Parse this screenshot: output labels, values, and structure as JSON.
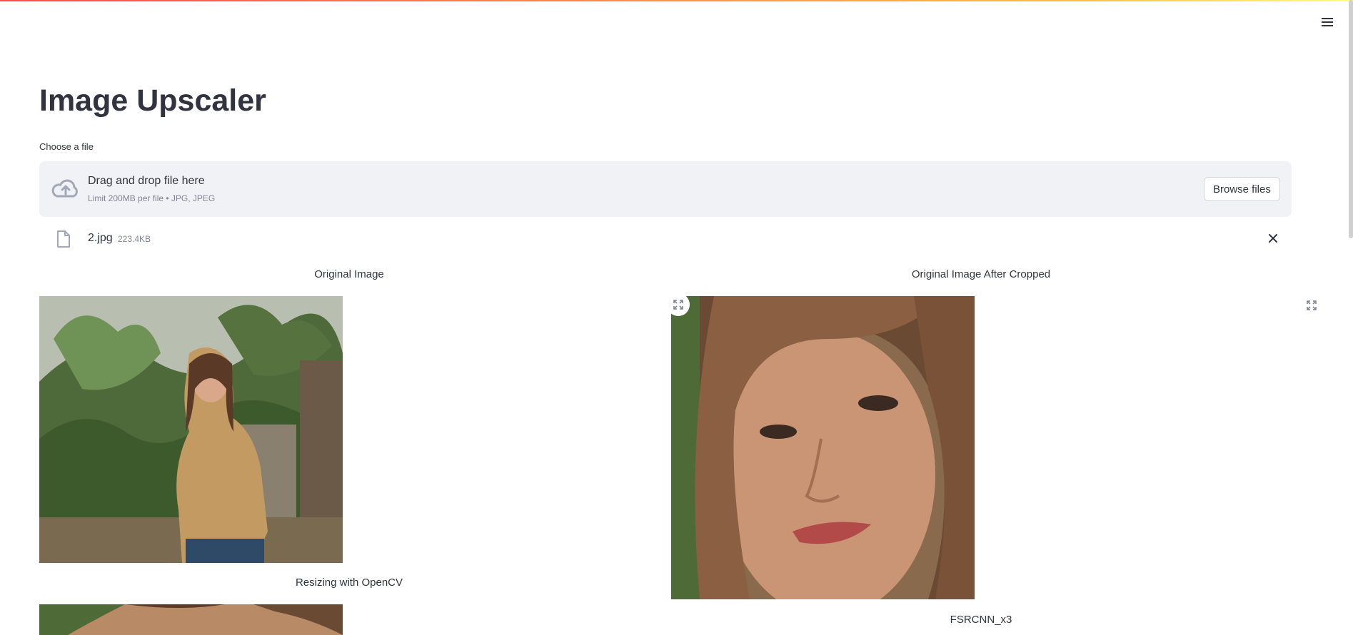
{
  "app": {
    "title": "Image Upscaler"
  },
  "header": {
    "menu_icon": "hamburger-menu-icon"
  },
  "uploader": {
    "label": "Choose a file",
    "drop_text": "Drag and drop file here",
    "limit_text": "Limit 200MB per file • JPG, JPEG",
    "browse_label": "Browse files",
    "icon": "cloud-upload-icon"
  },
  "uploaded_file": {
    "name": "2.jpg",
    "size": "223.4KB",
    "icon": "file-icon",
    "remove_icon": "close-icon"
  },
  "images": {
    "original_caption": "Original Image",
    "cropped_caption": "Original Image After Cropped",
    "opencv_caption": "Resizing with OpenCV",
    "fsrcnn_caption": "FSRCNN_x3"
  },
  "colors": {
    "accent_gradient_start": "#ff4b4b",
    "accent_gradient_end": "#fffd80",
    "dropzone_bg": "#f0f2f6",
    "text": "#31333f",
    "muted_text": "#808495"
  }
}
